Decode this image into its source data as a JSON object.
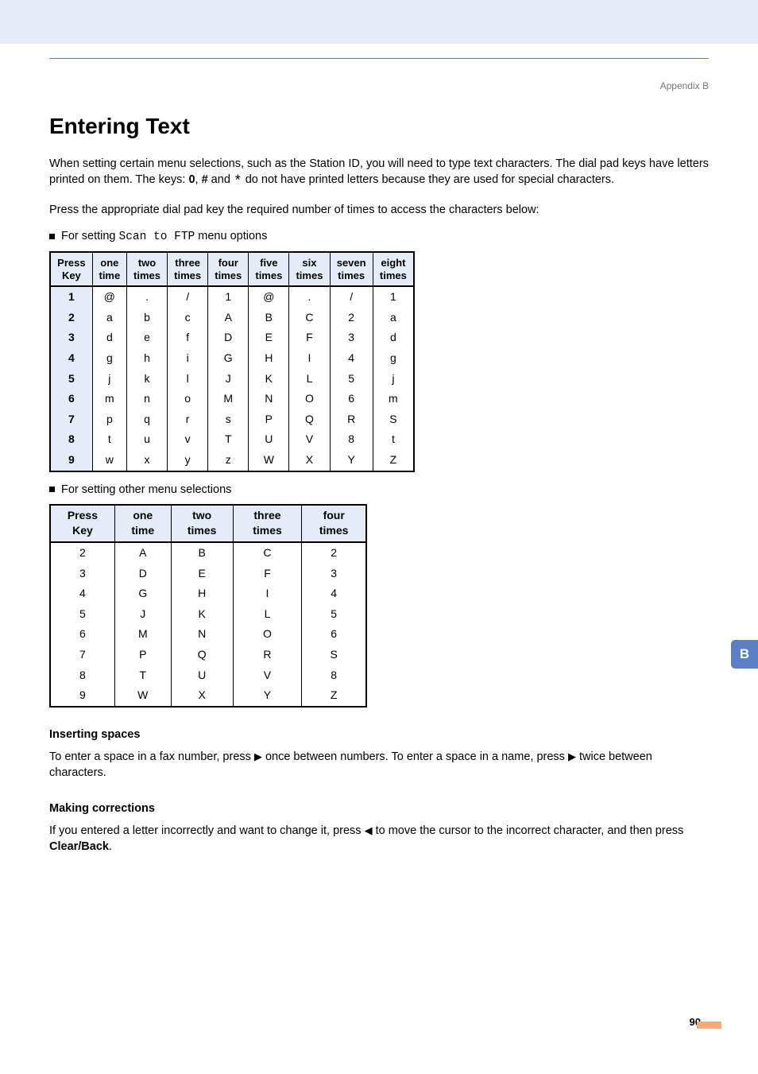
{
  "appendix_label": "Appendix B",
  "title": "Entering Text",
  "intro_p1_a": "When setting certain menu selections, such as the Station ID, you will need to type text characters. The dial pad keys have letters printed on them. The keys: ",
  "intro_p1_b": " and ",
  "intro_p1_c": " do not have printed letters because they are used for special characters.",
  "key0": "0",
  "keyhash": "#",
  "keystar": " *",
  "intro_p2": "Press the appropriate dial pad key the required number of times to access the characters below:",
  "bullet1_a": "For setting ",
  "bullet1_mono": "Scan to FTP",
  "bullet1_b": " menu options",
  "bullet2": "For setting other menu selections",
  "t1_headers": [
    "Press Key",
    "one time",
    "two times",
    "three times",
    "four times",
    "five times",
    "six times",
    "seven times",
    "eight times"
  ],
  "t1_rows": [
    [
      "1",
      "@",
      ".",
      "/",
      "1",
      "@",
      ".",
      "/",
      "1"
    ],
    [
      "2",
      "a",
      "b",
      "c",
      "A",
      "B",
      "C",
      "2",
      "a"
    ],
    [
      "3",
      "d",
      "e",
      "f",
      "D",
      "E",
      "F",
      "3",
      "d"
    ],
    [
      "4",
      "g",
      "h",
      "i",
      "G",
      "H",
      "I",
      "4",
      "g"
    ],
    [
      "5",
      "j",
      "k",
      "l",
      "J",
      "K",
      "L",
      "5",
      "j"
    ],
    [
      "6",
      "m",
      "n",
      "o",
      "M",
      "N",
      "O",
      "6",
      "m"
    ],
    [
      "7",
      "p",
      "q",
      "r",
      "s",
      "P",
      "Q",
      "R",
      "S"
    ],
    [
      "8",
      "t",
      "u",
      "v",
      "T",
      "U",
      "V",
      "8",
      "t"
    ],
    [
      "9",
      "w",
      "x",
      "y",
      "z",
      "W",
      "X",
      "Y",
      "Z"
    ]
  ],
  "t2_headers": [
    "Press Key",
    "one time",
    "two times",
    "three times",
    "four times"
  ],
  "t2_rows": [
    [
      "2",
      "A",
      "B",
      "C",
      "2"
    ],
    [
      "3",
      "D",
      "E",
      "F",
      "3"
    ],
    [
      "4",
      "G",
      "H",
      "I",
      "4"
    ],
    [
      "5",
      "J",
      "K",
      "L",
      "5"
    ],
    [
      "6",
      "M",
      "N",
      "O",
      "6"
    ],
    [
      "7",
      "P",
      "Q",
      "R",
      "S"
    ],
    [
      "8",
      "T",
      "U",
      "V",
      "8"
    ],
    [
      "9",
      "W",
      "X",
      "Y",
      "Z"
    ]
  ],
  "spaces_head": "Inserting spaces",
  "spaces_p_a": "To enter a space in a fax number, press ",
  "spaces_p_b": " once between numbers. To enter a space in a name, press ",
  "spaces_p_c": " twice between characters.",
  "arrow_right": "▶",
  "arrow_left": "◀",
  "corr_head": "Making corrections",
  "corr_p_a": "If you entered a letter incorrectly and want to change it, press ",
  "corr_p_b": " to move the cursor to the incorrect character, and then press ",
  "corr_p_c": ".",
  "clear_back": "Clear/Back",
  "side_tab": "B",
  "page_number": "90"
}
